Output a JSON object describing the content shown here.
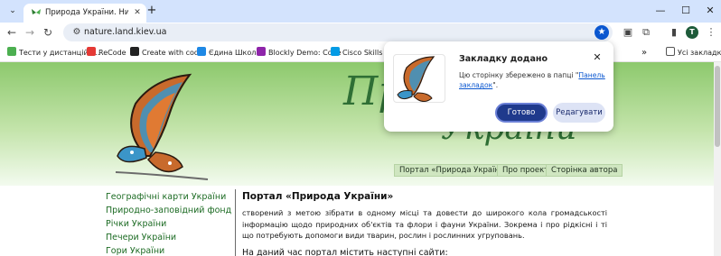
{
  "tab": {
    "title": "Природа України. Низка сайтів"
  },
  "toolbar": {
    "url": "nature.land.kiev.ua"
  },
  "bookmarks_bar": {
    "items": [
      {
        "label": "Тести у дистанційн...",
        "icon": "green-leaf-icon"
      },
      {
        "label": "ReCode",
        "icon": "recode-icon"
      },
      {
        "label": "Create with code",
        "icon": "unity-icon"
      },
      {
        "label": "Єдина Школа",
        "icon": "school-icon"
      },
      {
        "label": "Blockly Demo: Code",
        "icon": "blockly-icon"
      },
      {
        "label": "Cisco Skills For",
        "icon": "cisco-icon"
      }
    ],
    "all_bookmarks": "Усі закладки"
  },
  "popup": {
    "title": "Закладку додано",
    "message_prefix": "Цю сторінку збережено в папці \"",
    "folder_link": "Панель закладок",
    "message_suffix": "\".",
    "done_label": "Готово",
    "edit_label": "Редагувати"
  },
  "site": {
    "title_line1": "Природа",
    "title_line2": "України",
    "nav": [
      "Портал «Природа України»",
      "Про проект",
      "Сторінка автора"
    ],
    "sidebar_links": [
      "Географічні карти України",
      "Природно-заповідний фонд",
      "Річки України",
      "Печери України",
      "Гори України"
    ],
    "heading": "Портал «Природа України»",
    "intro": "створений з метою зібрати в одному місці та довести до широкого кола громадськості інформацію щодо природних об'єктів та флори і фауни України. Зокрема і про рідкісні і ті що потребують допомоги види тварин, рослин і рослинних угруповань.",
    "subheading": "На даний час портал містить наступні сайти:"
  },
  "colors": {
    "accent": "#0b57d0",
    "tabstrip": "#d3e3fd",
    "site_green": "#2f6f35",
    "link_green": "#1c6b23",
    "done_button": "#1f3a8c"
  }
}
